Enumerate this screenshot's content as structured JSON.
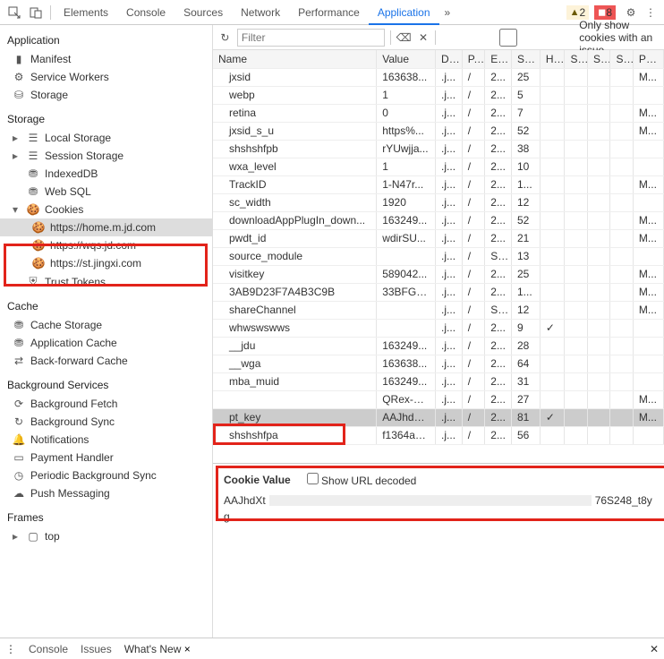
{
  "top": {
    "tabs": [
      "Elements",
      "Console",
      "Sources",
      "Network",
      "Performance",
      "Application"
    ],
    "active": "Application",
    "more": "»",
    "warn_count": "2",
    "err_count": "8"
  },
  "sidebar": {
    "application": {
      "title": "Application",
      "items": [
        "Manifest",
        "Service Workers",
        "Storage"
      ]
    },
    "storage": {
      "title": "Storage",
      "local": "Local Storage",
      "session": "Session Storage",
      "indexed": "IndexedDB",
      "websql": "Web SQL",
      "cookies": "Cookies",
      "cookie_hosts": [
        "https://home.m.jd.com",
        "https://wqs.jd.com",
        "https://st.jingxi.com"
      ],
      "trust": "Trust Tokens"
    },
    "cache": {
      "title": "Cache",
      "items": [
        "Cache Storage",
        "Application Cache",
        "Back-forward Cache"
      ]
    },
    "bg": {
      "title": "Background Services",
      "items": [
        "Background Fetch",
        "Background Sync",
        "Notifications",
        "Payment Handler",
        "Periodic Background Sync",
        "Push Messaging"
      ]
    },
    "frames": {
      "title": "Frames",
      "top": "top"
    }
  },
  "toolbar": {
    "filter_placeholder": "Filter",
    "only_issue": "Only show cookies with an issue"
  },
  "columns": [
    "Name",
    "Value",
    "D...",
    "P...",
    "E...",
    "Si...",
    "H...",
    "S...",
    "S...",
    "S...",
    "Pr..."
  ],
  "rows": [
    {
      "n": "jxsid",
      "v": "163638...",
      "d": ".j...",
      "p": "/",
      "e": "2...",
      "s": "25",
      "h": "",
      "pr": "M..."
    },
    {
      "n": "webp",
      "v": "1",
      "d": ".j...",
      "p": "/",
      "e": "2...",
      "s": "5",
      "h": "",
      "pr": ""
    },
    {
      "n": "retina",
      "v": "0",
      "d": ".j...",
      "p": "/",
      "e": "2...",
      "s": "7",
      "h": "",
      "pr": "M..."
    },
    {
      "n": "jxsid_s_u",
      "v": "https%...",
      "d": ".j...",
      "p": "/",
      "e": "2...",
      "s": "52",
      "h": "",
      "pr": "M..."
    },
    {
      "n": "shshshfpb",
      "v": "rYUwjja...",
      "d": ".j...",
      "p": "/",
      "e": "2...",
      "s": "38",
      "h": "",
      "pr": ""
    },
    {
      "n": "wxa_level",
      "v": "1",
      "d": ".j...",
      "p": "/",
      "e": "2...",
      "s": "10",
      "h": "",
      "pr": ""
    },
    {
      "n": "TrackID",
      "v": "1-N47r...",
      "d": ".j...",
      "p": "/",
      "e": "2...",
      "s": "1...",
      "h": "",
      "pr": "M..."
    },
    {
      "n": "sc_width",
      "v": "1920",
      "d": ".j...",
      "p": "/",
      "e": "2...",
      "s": "12",
      "h": "",
      "pr": ""
    },
    {
      "n": "downloadAppPlugIn_down...",
      "v": "163249...",
      "d": ".j...",
      "p": "/",
      "e": "2...",
      "s": "52",
      "h": "",
      "pr": "M..."
    },
    {
      "n": "pwdt_id",
      "v": "wdirSU...",
      "d": ".j...",
      "p": "/",
      "e": "2...",
      "s": "21",
      "h": "",
      "pr": "M..."
    },
    {
      "n": "source_module",
      "v": "",
      "d": ".j...",
      "p": "/",
      "e": "S...",
      "s": "13",
      "h": "",
      "pr": ""
    },
    {
      "n": "visitkey",
      "v": "589042...",
      "d": ".j...",
      "p": "/",
      "e": "2...",
      "s": "25",
      "h": "",
      "pr": "M..."
    },
    {
      "n": "3AB9D23F7A4B3C9B",
      "v": "33BFG7...",
      "d": ".j...",
      "p": "/",
      "e": "2...",
      "s": "1...",
      "h": "",
      "pr": "M..."
    },
    {
      "n": "shareChannel",
      "v": "",
      "d": ".j...",
      "p": "/",
      "e": "S...",
      "s": "12",
      "h": "",
      "pr": "M..."
    },
    {
      "n": "whwswswws",
      "v": "",
      "d": ".j...",
      "p": "/",
      "e": "2...",
      "s": "9",
      "h": "✓",
      "pr": ""
    },
    {
      "n": "__jdu",
      "v": "163249...",
      "d": ".j...",
      "p": "/",
      "e": "2...",
      "s": "28",
      "h": "",
      "pr": ""
    },
    {
      "n": "__wga",
      "v": "163638...",
      "d": ".j...",
      "p": "/",
      "e": "2...",
      "s": "64",
      "h": "",
      "pr": ""
    },
    {
      "n": "mba_muid",
      "v": "163249...",
      "d": ".j...",
      "p": "/",
      "e": "2...",
      "s": "31",
      "h": "",
      "pr": ""
    },
    {
      "n": "",
      "v": "QRex-G...",
      "d": ".j...",
      "p": "/",
      "e": "2...",
      "s": "27",
      "h": "",
      "pr": "M..."
    },
    {
      "n": "pt_key",
      "v": "AAJhdX...",
      "d": ".j...",
      "p": "/",
      "e": "2...",
      "s": "81",
      "h": "✓",
      "pr": "M...",
      "sel": true
    },
    {
      "n": "shshshfpa",
      "v": "f1364ae...",
      "d": ".j...",
      "p": "/",
      "e": "2...",
      "s": "56",
      "h": "",
      "pr": ""
    }
  ],
  "detail": {
    "label": "Cookie Value",
    "decoded": "Show URL decoded",
    "prefix": "AAJhdXt",
    "suffix": "76S248_t8yg"
  },
  "bottom": {
    "tabs": [
      "Console",
      "Issues",
      "What's New"
    ],
    "active": "What's New"
  }
}
